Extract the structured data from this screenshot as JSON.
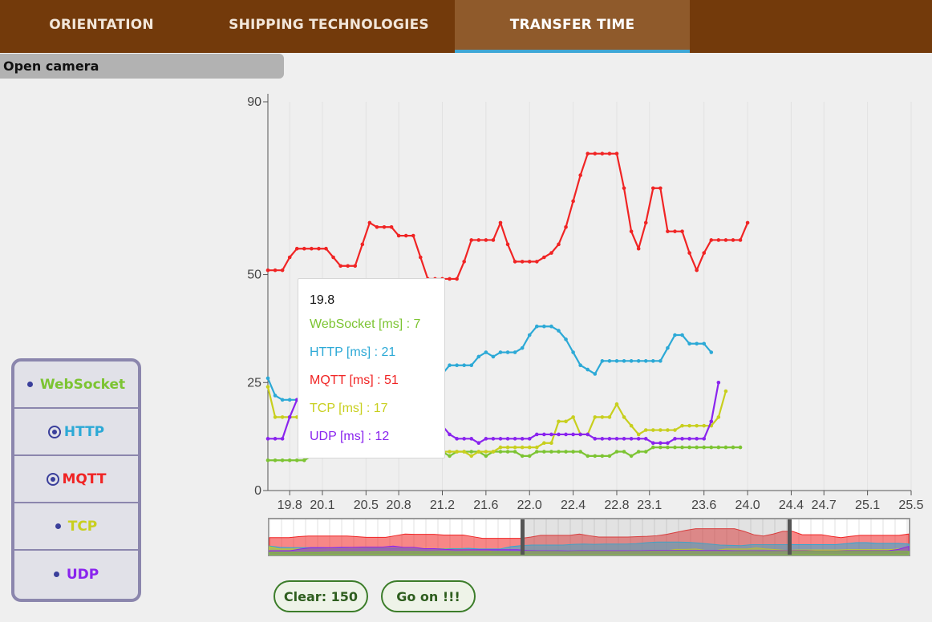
{
  "nav": {
    "tabs": [
      {
        "label": "ORIENTATION"
      },
      {
        "label": "SHIPPING TECHNOLOGIES"
      },
      {
        "label": "TRANSFER TIME",
        "active": true
      }
    ]
  },
  "camera": {
    "label": "Open camera"
  },
  "protocols": [
    {
      "label": "WebSocket",
      "color": "#7cc432",
      "selected": false
    },
    {
      "label": "HTTP",
      "color": "#2ca9d6",
      "selected": true
    },
    {
      "label": "MQTT",
      "color": "#f02424",
      "selected": true
    },
    {
      "label": "TCP",
      "color": "#c8cf1e",
      "selected": false
    },
    {
      "label": "UDP",
      "color": "#8a24ee",
      "selected": false
    }
  ],
  "buttons": {
    "clear": "Clear: 150",
    "go_on": "Go on !!!"
  },
  "tooltip": {
    "x": "19.8",
    "lines": [
      {
        "text": "WebSocket [ms] : 7",
        "color": "#7cc432"
      },
      {
        "text": "HTTP [ms] : 21",
        "color": "#2ca9d6"
      },
      {
        "text": "MQTT [ms] : 51",
        "color": "#f02424"
      },
      {
        "text": "TCP [ms] : 17",
        "color": "#c8cf1e"
      },
      {
        "text": "UDP [ms] : 12",
        "color": "#8a24ee"
      }
    ]
  },
  "chart_data": {
    "type": "line",
    "title": "",
    "xlabel": "",
    "ylabel": "",
    "ylim": [
      0,
      90
    ],
    "yticks": [
      "0",
      "25",
      "50",
      "90"
    ],
    "x_tick_labels": [
      "19.8",
      "20.1",
      "20.5",
      "20.8",
      "21.2",
      "21.6",
      "22.0",
      "22.4",
      "22.8",
      "23.1",
      "23.6",
      "24.0",
      "24.4",
      "24.7",
      "25.1",
      "25.5"
    ],
    "x_start": 19.6,
    "x_step": 0.0666667,
    "series": [
      {
        "name": "WebSocket [ms]",
        "color": "#7cc432",
        "values": [
          7,
          7,
          7,
          7,
          7,
          7,
          8,
          8,
          8,
          8,
          8,
          9,
          9,
          9,
          9,
          9,
          8,
          9,
          9,
          8,
          9,
          9,
          8,
          9,
          9,
          8,
          9,
          9,
          9,
          9,
          8,
          9,
          9,
          9,
          9,
          8,
          8,
          9,
          9,
          9,
          9,
          9,
          9,
          9,
          8,
          8,
          8,
          8,
          9,
          9,
          8,
          9,
          9,
          10,
          10,
          10,
          10,
          10,
          10,
          10,
          10,
          10,
          10,
          10,
          10,
          10
        ]
      },
      {
        "name": "HTTP [ms]",
        "color": "#2ca9d6",
        "values": [
          26,
          22,
          21,
          21,
          21,
          21,
          20,
          20,
          19,
          19,
          18,
          18,
          18,
          18,
          17,
          17,
          18,
          18,
          18,
          19,
          17,
          17,
          17,
          24,
          27,
          29,
          29,
          29,
          29,
          31,
          32,
          31,
          32,
          32,
          32,
          33,
          36,
          38,
          38,
          38,
          37,
          35,
          32,
          29,
          28,
          27,
          30,
          30,
          30,
          30,
          30,
          30,
          30,
          30,
          30,
          33,
          36,
          36,
          34,
          34,
          34,
          32
        ]
      },
      {
        "name": "MQTT [ms]",
        "color": "#f02424",
        "values": [
          51,
          51,
          51,
          54,
          56,
          56,
          56,
          56,
          56,
          54,
          52,
          52,
          52,
          57,
          62,
          61,
          61,
          61,
          59,
          59,
          59,
          54,
          49,
          49,
          49,
          49,
          49,
          53,
          58,
          58,
          58,
          58,
          62,
          57,
          53,
          53,
          53,
          53,
          54,
          55,
          57,
          61,
          67,
          73,
          78,
          78,
          78,
          78,
          78,
          70,
          60,
          56,
          62,
          70,
          70,
          60,
          60,
          60,
          55,
          51,
          55,
          58,
          58,
          58,
          58,
          58,
          62
        ]
      },
      {
        "name": "TCP [ms]",
        "color": "#c8cf1e",
        "values": [
          24,
          17,
          17,
          17,
          17,
          17,
          18,
          18,
          19,
          20,
          21,
          21,
          21,
          20,
          19,
          19,
          18,
          17,
          16,
          16,
          15,
          14,
          10,
          9,
          9,
          9,
          9,
          9,
          8,
          9,
          9,
          9,
          10,
          10,
          10,
          10,
          10,
          10,
          11,
          11,
          16,
          16,
          17,
          13,
          13,
          17,
          17,
          17,
          20,
          17,
          15,
          13,
          14,
          14,
          14,
          14,
          14,
          15,
          15,
          15,
          15,
          15,
          17,
          23
        ]
      },
      {
        "name": "UDP [ms]",
        "color": "#8a24ee",
        "values": [
          12,
          12,
          12,
          17,
          21,
          21,
          21,
          22,
          22,
          23,
          23,
          23,
          26,
          22,
          22,
          18,
          18,
          16,
          15,
          15,
          15,
          15,
          15,
          15,
          15,
          13,
          12,
          12,
          12,
          11,
          12,
          12,
          12,
          12,
          12,
          12,
          12,
          13,
          13,
          13,
          13,
          13,
          13,
          13,
          13,
          12,
          12,
          12,
          12,
          12,
          12,
          12,
          12,
          11,
          11,
          11,
          12,
          12,
          12,
          12,
          12,
          16,
          25
        ]
      }
    ]
  }
}
